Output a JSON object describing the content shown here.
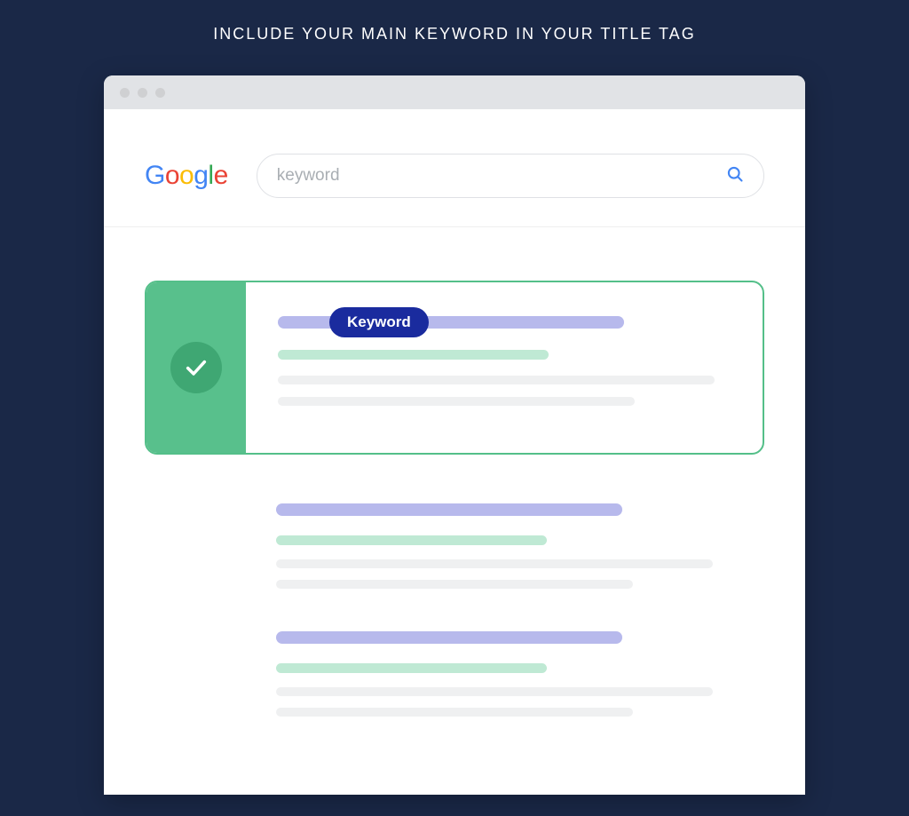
{
  "heading": "INCLUDE YOUR MAIN KEYWORD IN YOUR TITLE TAG",
  "logo": {
    "g1": "G",
    "o1": "o",
    "o2": "o",
    "g2": "g",
    "l": "l",
    "e": "e"
  },
  "search": {
    "query": "keyword"
  },
  "highlighted_result": {
    "keyword_label": "Keyword"
  }
}
